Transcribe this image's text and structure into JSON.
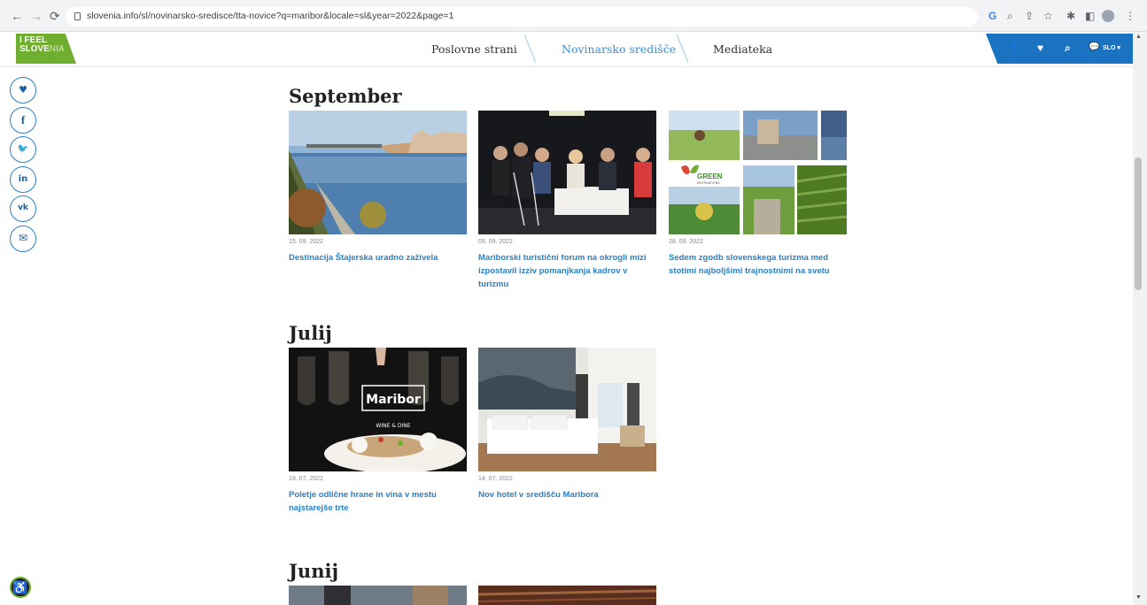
{
  "browser": {
    "back_icon": "back-arrow-icon",
    "forward_icon": "forward-arrow-icon",
    "reload_icon": "reload-icon",
    "url": "slovenia.info/sl/novinarsko-sredisce/tta-novice?q=maribor&locale=sl&year=2022&page=1",
    "google_icon": "G",
    "zoom_glyph": "⌕",
    "share_glyph": "⇪",
    "star_glyph": "☆",
    "ext_glyph": "✱",
    "sidepanel_glyph": "◧",
    "menu_glyph": "⋮"
  },
  "header": {
    "logo_line1": "I FEEL",
    "logo_line2_a": "S",
    "logo_line2_b": "LOVE",
    "logo_line2_c": "NIA",
    "nav": [
      {
        "label": "Poslovne strani"
      },
      {
        "label": "Novinarsko središče"
      },
      {
        "label": "Mediateka"
      }
    ],
    "util": {
      "user_glyph": "👤",
      "heart_glyph": "♥",
      "search_glyph": "⌕",
      "chat_glyph": "💬",
      "lang": "SLO ▾"
    }
  },
  "social": [
    {
      "glyph": "♥"
    },
    {
      "glyph": "f"
    },
    {
      "glyph": "🐦"
    },
    {
      "glyph": "in"
    },
    {
      "glyph": "vk"
    },
    {
      "glyph": "✉"
    }
  ],
  "accessibility_glyph": "♿",
  "sections": [
    {
      "month": "September",
      "articles": [
        {
          "date": "15. 09. 2022",
          "title": "Destinacija Štajerska uradno zaživela"
        },
        {
          "date": "09. 09. 2022",
          "title": "Mariborski turistični forum na okrogli mizi izpostavil izziv pomanjkanja kadrov v turizmu"
        },
        {
          "date": "28. 09. 2022",
          "title": "Sedem zgodb slovenskega turizma med stotimi najboljšimi trajnostnimi na svetu"
        }
      ]
    },
    {
      "month": "Julij",
      "articles": [
        {
          "date": "19. 07. 2022",
          "title": "Poletje odlične hrane in vina v mestu najstarejše trte"
        },
        {
          "date": "14. 07. 2022",
          "title": "Nov hotel v središču Maribora"
        }
      ]
    },
    {
      "month": "Junij",
      "articles": []
    }
  ],
  "images": {
    "green_text": "GREEN",
    "green_sub": "DESTINATIONS",
    "maribor_logo": "Maribor",
    "wine_dine": "WINE & DINE"
  },
  "colors": {
    "brand_green": "#6fae2e",
    "brand_blue": "#1a73c1",
    "link_blue": "#2b7fc3"
  }
}
